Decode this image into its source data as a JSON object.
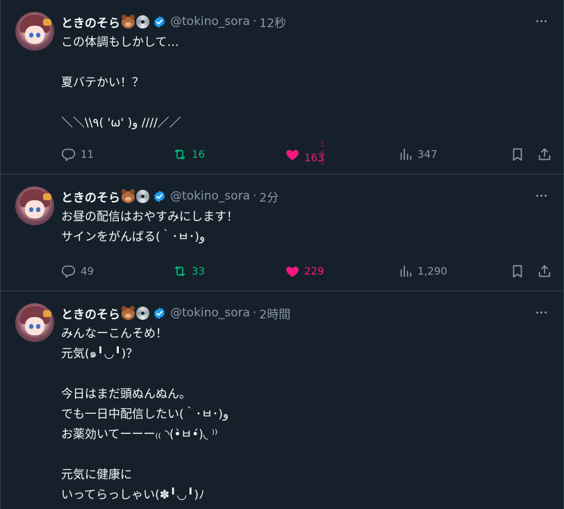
{
  "colors": {
    "background": "#15202b",
    "border": "#38444d",
    "text_primary": "#f7f9f9",
    "text_secondary": "#8b98a5",
    "verified_blue": "#1d9bf0",
    "retweet_green": "#00ba7c",
    "like_pink": "#f91880"
  },
  "icons": {
    "header": [
      "bear-emoji-icon",
      "disc-emoji-icon",
      "verified-badge-icon"
    ],
    "more": "more-dots-icon",
    "actions": [
      "reply-icon",
      "retweet-icon",
      "like-heart-icon",
      "views-chart-icon",
      "bookmark-icon",
      "share-icon"
    ]
  },
  "tweets": [
    {
      "name": "ときのそら",
      "handle": "@tokino_sora",
      "separator": "·",
      "time": "12秒",
      "text": "この体調もしかして…\n\n夏バテかい！？\n\n＼＼\\\\٩( 'ω' )و ////／／",
      "stats": {
        "replies": "11",
        "retweets": "16",
        "likes": "163",
        "likes_previous": "1 6 2",
        "views": "347"
      }
    },
    {
      "name": "ときのそら",
      "handle": "@tokino_sora",
      "separator": "·",
      "time": "2分",
      "text": "お昼の配信はおやすみにします！\nサインをがんばる(｀･ㅂ･)و",
      "stats": {
        "replies": "49",
        "retweets": "33",
        "likes": "229",
        "views": "1,290"
      }
    },
    {
      "name": "ときのそら",
      "handle": "@tokino_sora",
      "separator": "·",
      "time": "2時間",
      "text": "みんなーこんそめ！\n元気(๑╹◡╹)？\n\n今日はまだ頭ぬんぬん。\nでも一日中配信したい(｀･ㅂ･)و\nお薬効いてーーー₍₍ ◝(•̀ㅂ•́)◟ ⁾⁾\n\n元気に健康に\nいってらっしゃい(✽╹◡╹)ﾉ"
    }
  ]
}
